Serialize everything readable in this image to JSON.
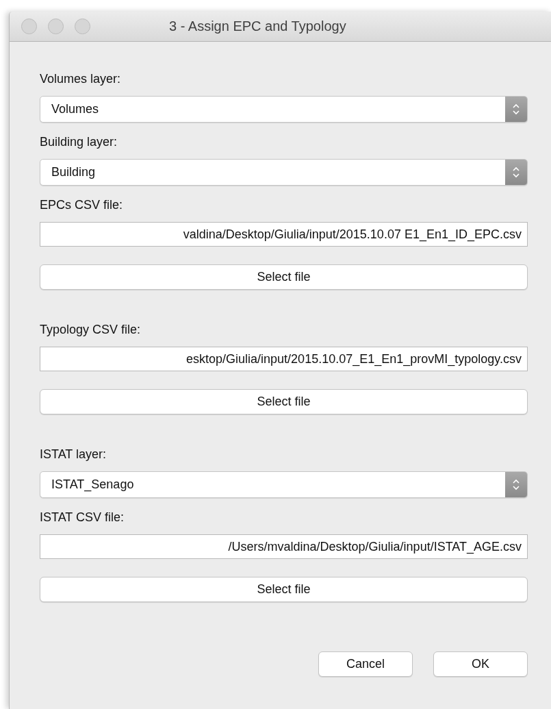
{
  "window": {
    "title": "3 - Assign EPC and Typology"
  },
  "fields": [
    {
      "kind": "combo",
      "label": "Volumes layer:",
      "value": "Volumes"
    },
    {
      "kind": "combo",
      "label": "Building layer:",
      "value": "Building"
    },
    {
      "kind": "file",
      "label": "EPCs CSV file:",
      "value": "valdina/Desktop/Giulia/input/2015.10.07 E1_En1_ID_EPC.csv",
      "button": "Select file"
    },
    {
      "kind": "file",
      "label": "Typology CSV file:",
      "value": "esktop/Giulia/input/2015.10.07_E1_En1_provMI_typology.csv",
      "button": "Select file"
    },
    {
      "kind": "combo",
      "label": "ISTAT layer:",
      "value": "ISTAT_Senago"
    },
    {
      "kind": "file",
      "label": "ISTAT CSV file:",
      "value": "/Users/mvaldina/Desktop/Giulia/input/ISTAT_AGE.csv",
      "button": "Select file"
    }
  ],
  "buttons": [
    "Cancel",
    "OK"
  ]
}
